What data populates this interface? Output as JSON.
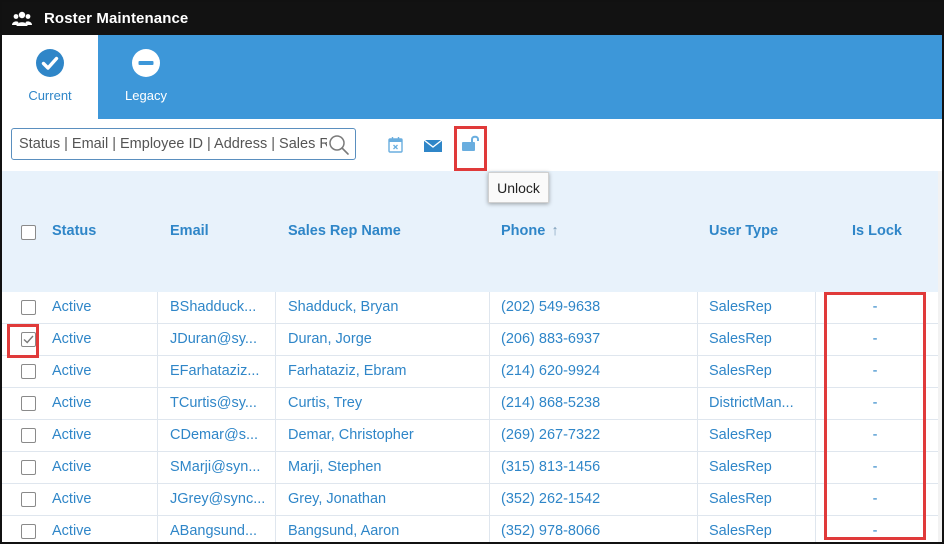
{
  "window": {
    "title": "Roster Maintenance",
    "icon": "users-icon"
  },
  "tabs": [
    {
      "label": "Current",
      "icon": "check-circle-icon",
      "active": true
    },
    {
      "label": "Legacy",
      "icon": "minus-circle-icon",
      "active": false
    }
  ],
  "toolbar": {
    "search_placeholder": "Status | Email | Employee ID | Address | Sales Rep Name",
    "icons": [
      "calendar-x-icon",
      "envelope-icon",
      "unlock-icon"
    ],
    "tooltip": "Unlock"
  },
  "table": {
    "columns": [
      "Status",
      "Email",
      "Sales Rep Name",
      "Phone",
      "User Type",
      "Is Lock"
    ],
    "sort": {
      "column": "Phone",
      "direction": "ascending",
      "indicator": "↑"
    },
    "rows": [
      {
        "checked": false,
        "status": "Active",
        "email": "BShadduck...",
        "name": "Shadduck, Bryan",
        "phone": "(202) 549-9638",
        "user_type": "SalesRep",
        "is_lock": "-"
      },
      {
        "checked": true,
        "status": "Active",
        "email": "JDuran@sy...",
        "name": "Duran, Jorge",
        "phone": "(206) 883-6937",
        "user_type": "SalesRep",
        "is_lock": "-"
      },
      {
        "checked": false,
        "status": "Active",
        "email": "EFarhataziz...",
        "name": "Farhataziz, Ebram",
        "phone": "(214) 620-9924",
        "user_type": "SalesRep",
        "is_lock": "-"
      },
      {
        "checked": false,
        "status": "Active",
        "email": "TCurtis@sy...",
        "name": "Curtis, Trey",
        "phone": "(214) 868-5238",
        "user_type": "DistrictMan...",
        "is_lock": "-"
      },
      {
        "checked": false,
        "status": "Active",
        "email": "CDemar@s...",
        "name": "Demar, Christopher",
        "phone": "(269) 267-7322",
        "user_type": "SalesRep",
        "is_lock": "-"
      },
      {
        "checked": false,
        "status": "Active",
        "email": "SMarji@syn...",
        "name": "Marji, Stephen",
        "phone": "(315) 813-1456",
        "user_type": "SalesRep",
        "is_lock": "-"
      },
      {
        "checked": false,
        "status": "Active",
        "email": "JGrey@sync...",
        "name": "Grey, Jonathan",
        "phone": "(352) 262-1542",
        "user_type": "SalesRep",
        "is_lock": "-"
      },
      {
        "checked": false,
        "status": "Active",
        "email": "ABangsund...",
        "name": "Bangsund, Aaron",
        "phone": "(352) 978-8066",
        "user_type": "SalesRep",
        "is_lock": "-"
      }
    ]
  },
  "colors": {
    "accent": "#3d97d9",
    "link": "#2f86c8",
    "header_bg": "#e8f2fb",
    "highlight": "#e03a3a",
    "titlebar": "#121212"
  }
}
